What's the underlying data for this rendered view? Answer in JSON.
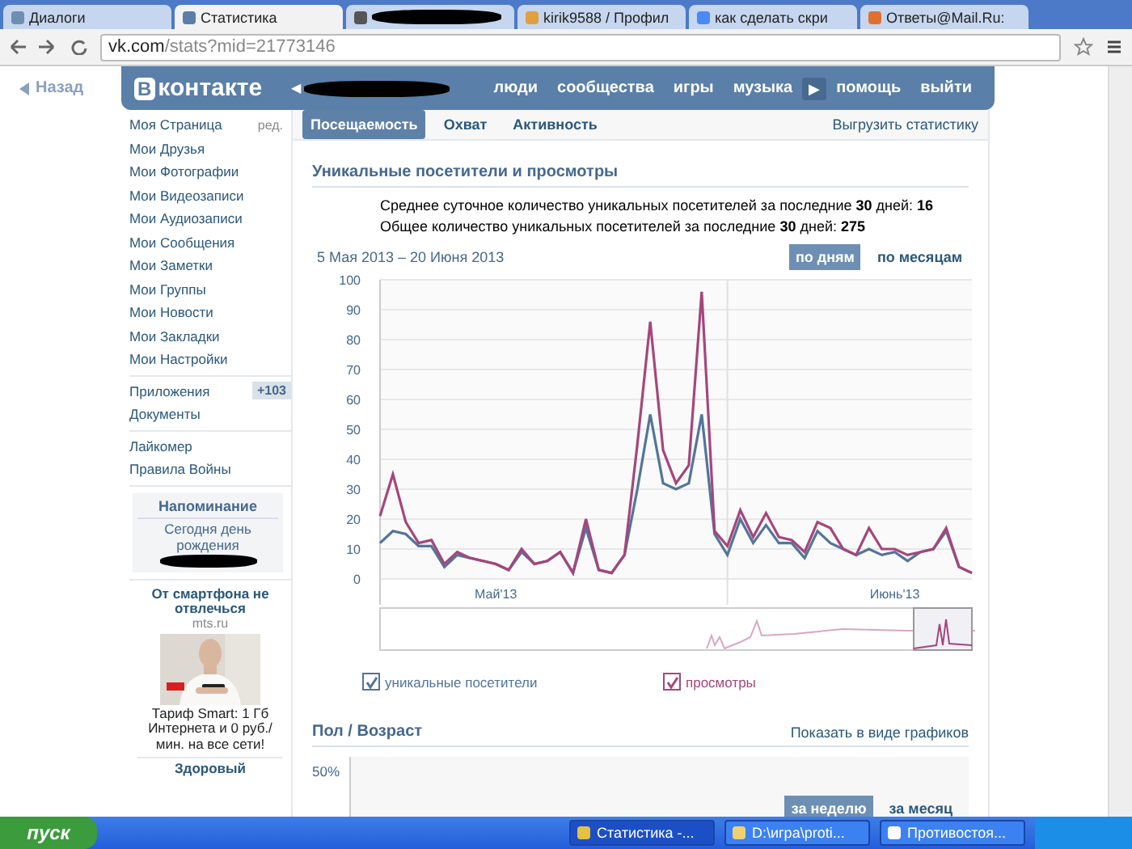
{
  "browser": {
    "tabs": [
      {
        "kind": "page",
        "title": "Диалоги",
        "selected": false
      },
      {
        "kind": "page",
        "title": "Статистика",
        "selected": true
      },
      {
        "kind": "redacted",
        "selected": false
      },
      {
        "kind": "page",
        "title": "kirik9588 / Профил",
        "selected": false
      },
      {
        "kind": "page",
        "title": "как сделать скри",
        "selected": false
      },
      {
        "kind": "page",
        "title": "Ответы@Mail.Ru:",
        "selected": false
      }
    ],
    "address_host": "vk.com",
    "address_path": "/stats?mid=21773146"
  },
  "back_link": "Назад",
  "header": {
    "logo_mark": "В",
    "logo_text": "контакте",
    "back_arrow": "◀",
    "nav": [
      {
        "kind": "link",
        "label": "люди"
      },
      {
        "kind": "link",
        "label": "сообщества"
      },
      {
        "kind": "link",
        "label": "игры"
      },
      {
        "kind": "link",
        "label": "музыка"
      },
      {
        "kind": "arrow",
        "label": "▶"
      },
      {
        "kind": "link",
        "label": "помощь"
      },
      {
        "kind": "link",
        "label": "выйти"
      }
    ]
  },
  "sidebar": {
    "groups": [
      [
        {
          "label": "Моя Страница",
          "aside": "ред."
        },
        {
          "label": "Мои Друзья"
        },
        {
          "label": "Мои Фотографии"
        },
        {
          "label": "Мои Видеозаписи"
        },
        {
          "label": "Мои Аудиозаписи"
        },
        {
          "label": "Мои Сообщения"
        },
        {
          "label": "Мои Заметки"
        },
        {
          "label": "Мои Группы"
        },
        {
          "label": "Мои Новости"
        },
        {
          "label": "Мои Закладки"
        },
        {
          "label": "Мои Настройки"
        }
      ],
      [
        {
          "label": "Приложения",
          "badge": "+103"
        },
        {
          "label": "Документы"
        }
      ],
      [
        {
          "label": "Лайкомер"
        },
        {
          "label": "Правила Войны"
        }
      ]
    ],
    "reminder": {
      "title": "Напоминание",
      "text": "Сегодня день рождения"
    },
    "ad": {
      "title": "От смартфона не отвлечься",
      "domain": "mts.ru",
      "text": "Тариф Smart: 1 Гб Интернета и 0 руб./ мин. на все сети!"
    },
    "next_ad_title": "Здоровый"
  },
  "stat_tabs": [
    {
      "label": "Посещаемость",
      "selected": true
    },
    {
      "label": "Охват",
      "selected": false
    },
    {
      "label": "Активность",
      "selected": false
    }
  ],
  "export_link": "Выгрузить статистику",
  "visitors": {
    "title": "Уникальные посетители и просмотры",
    "summary": [
      "Среднее суточное количество уникальных посетителей за последние **30** дней: **16**",
      "Общее количество уникальных посетителей за последние **30** дней: **275**"
    ],
    "date_range": "5 Мая 2013 – 20 Июня 2013",
    "period_toggles": [
      {
        "label": "по дням",
        "selected": true
      },
      {
        "label": "по месяцам",
        "selected": false
      }
    ],
    "chart_data": {
      "type": "line",
      "ylim": [
        0,
        100
      ],
      "yticks": [
        0,
        10,
        20,
        30,
        40,
        50,
        60,
        70,
        80,
        90,
        100
      ],
      "grid": true,
      "series": [
        {
          "name": "уникальные посетители",
          "color": "#52759b",
          "values": [
            12,
            16,
            15,
            11,
            11,
            4,
            8,
            7,
            6,
            5,
            3,
            9,
            5,
            6,
            9,
            2,
            17,
            3,
            2,
            8,
            30,
            55,
            32,
            30,
            32,
            55,
            15,
            8,
            20,
            12,
            18,
            12,
            12,
            7,
            16,
            12,
            10,
            8,
            10,
            8,
            9,
            6,
            9,
            10,
            16,
            4,
            2
          ]
        },
        {
          "name": "просмотры",
          "color": "#a5467c",
          "values": [
            21,
            35,
            19,
            12,
            13,
            5,
            9,
            7,
            6,
            5,
            3,
            10,
            5,
            6,
            9,
            2,
            20,
            3,
            2,
            8,
            45,
            86,
            43,
            32,
            38,
            96,
            16,
            11,
            23,
            14,
            22,
            14,
            13,
            9,
            19,
            17,
            10,
            8,
            17,
            10,
            10,
            8,
            9,
            10,
            17,
            4,
            2
          ]
        }
      ]
    },
    "month_labels": [
      "Май'13",
      "Июнь'13"
    ],
    "legend": [
      {
        "checked": true
      },
      {
        "checked": true
      }
    ]
  },
  "demographics": {
    "title": "Пол / Возраст",
    "link": "Показать в виде графиков",
    "y_tick": "50%",
    "period_toggles": [
      {
        "label": "за неделю",
        "selected": true
      },
      {
        "label": "за месяц",
        "selected": false
      }
    ]
  },
  "taskbar": {
    "start": "пуск",
    "tasks": [
      {
        "kind": "browser",
        "title": "Статистика -...",
        "selected": true
      },
      {
        "kind": "folder",
        "title": "D:\\игра\\proti...",
        "selected": false
      },
      {
        "kind": "window",
        "title": "Противостоя...",
        "selected": false
      }
    ]
  }
}
